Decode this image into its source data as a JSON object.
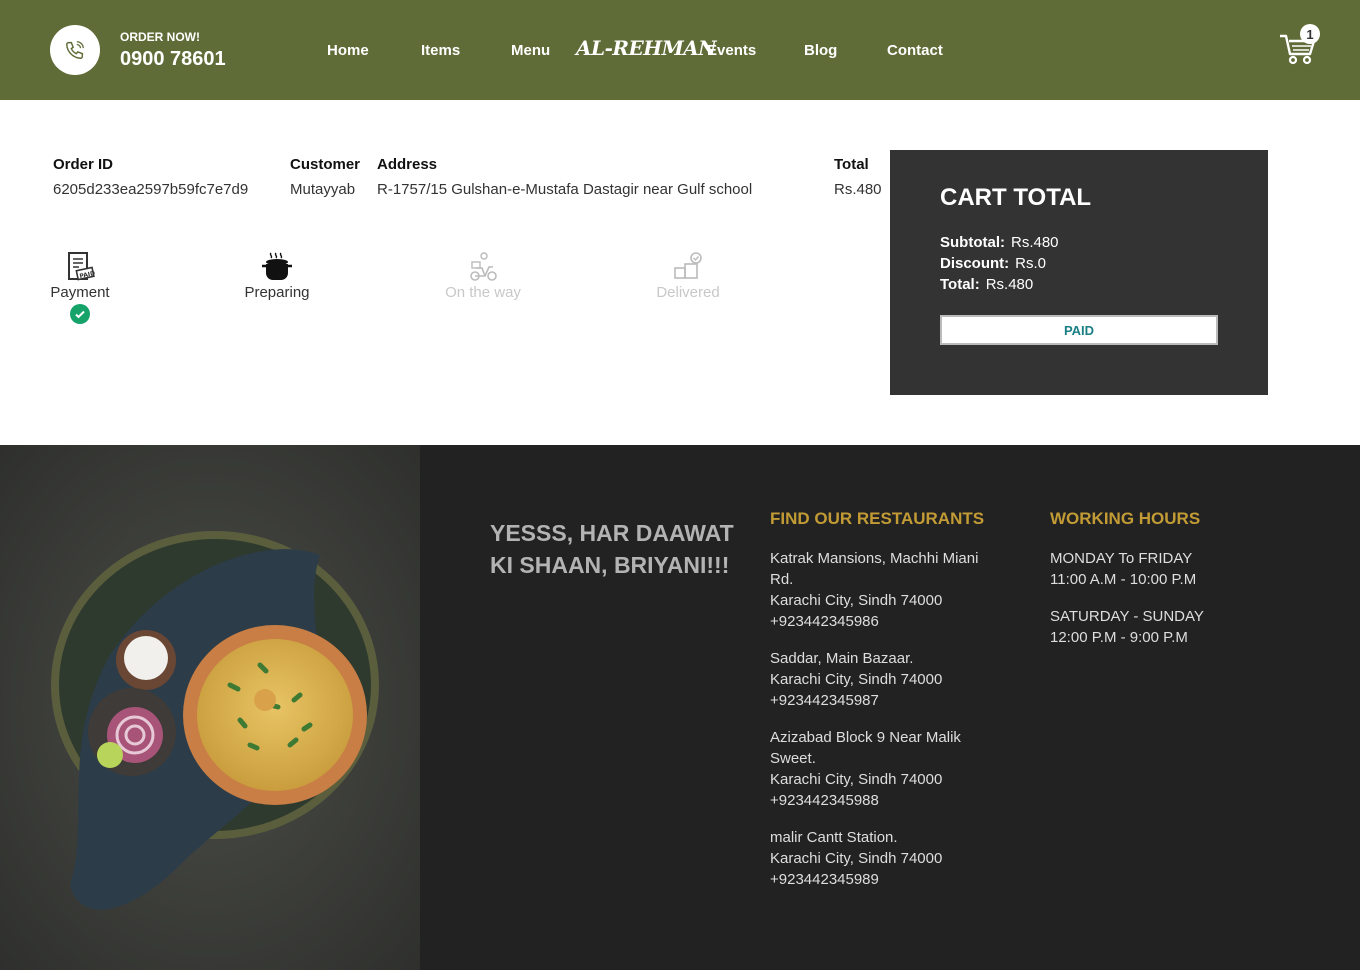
{
  "header": {
    "order_now": "ORDER NOW!",
    "phone": "0900 78601",
    "nav": [
      "Home",
      "Items",
      "Menu",
      "Events",
      "Blog",
      "Contact"
    ],
    "logo": "AL-REHMAN",
    "cart_count": "1",
    "colors": {
      "bar": "#606c38"
    }
  },
  "order": {
    "headers": {
      "id": "Order ID",
      "customer": "Customer",
      "address": "Address",
      "total": "Total"
    },
    "id": "6205d233ea2597b59fc7e7d9",
    "customer": "Mutayyab",
    "address": "R-1757/15 Gulshan-e-Mustafa Dastagir near Gulf school",
    "total": "Rs.480"
  },
  "stages": [
    {
      "label": "Payment",
      "icon": "paid-receipt-icon",
      "state": "done"
    },
    {
      "label": "Preparing",
      "icon": "cooking-pot-icon",
      "state": "active"
    },
    {
      "label": "On the way",
      "icon": "delivery-scooter-icon",
      "state": "pending"
    },
    {
      "label": "Delivered",
      "icon": "delivered-package-icon",
      "state": "pending"
    }
  ],
  "cart_total": {
    "title": "CART TOTAL",
    "subtotal_label": "Subtotal:",
    "subtotal": "Rs.480",
    "discount_label": "Discount:",
    "discount": "Rs.0",
    "total_label": "Total:",
    "total": "Rs.480",
    "button": "PAID"
  },
  "footer": {
    "slogan": "YESSS, HAR DAAWAT KI SHAAN, BRIYANI!!!",
    "restaurants_title": "FIND OUR RESTAURANTS",
    "restaurants": [
      {
        "line1": "Katrak Mansions, Machhi Miani Rd.",
        "line2": "Karachi City, Sindh 74000",
        "phone": "+923442345986"
      },
      {
        "line1": "Saddar, Main Bazaar.",
        "line2": "Karachi City, Sindh 74000",
        "phone": "+923442345987"
      },
      {
        "line1": "Azizabad Block 9 Near Malik Sweet.",
        "line2": "Karachi City, Sindh 74000",
        "phone": "+923442345988"
      },
      {
        "line1": "malir Cantt Station.",
        "line2": "Karachi City, Sindh 74000",
        "phone": "+923442345989"
      }
    ],
    "hours_title": "WORKING HOURS",
    "hours": [
      {
        "days": "MONDAY To FRIDAY",
        "time": "11:00 A.M - 10:00 P.M"
      },
      {
        "days": "SATURDAY - SUNDAY",
        "time": "12:00 P.M - 9:00 P.M"
      }
    ],
    "colors": {
      "title": "#c29b35",
      "background": "#222222"
    }
  }
}
